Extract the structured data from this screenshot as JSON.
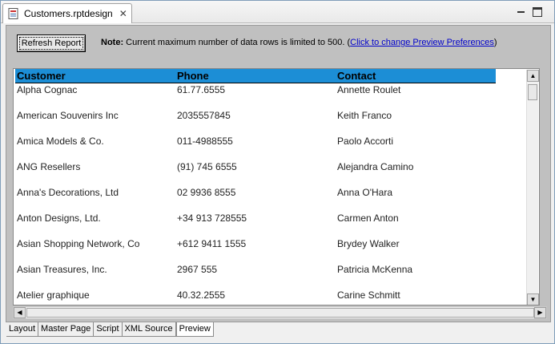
{
  "editor_tab": {
    "title": "Customers.rptdesign",
    "close_glyph": "✕"
  },
  "toolbar": {
    "refresh_label": "Refresh Report",
    "note_label": "Note:",
    "note_text": " Current maximum number of data rows is limited to 500. (",
    "note_link": "Click to change Preview Preferences",
    "note_tail": ")"
  },
  "report": {
    "columns": [
      "Customer",
      "Phone",
      "Contact"
    ],
    "rows": [
      [
        "Alpha Cognac",
        "61.77.6555",
        "Annette  Roulet"
      ],
      [
        "American Souvenirs Inc",
        "2035557845",
        "Keith Franco"
      ],
      [
        "Amica Models & Co.",
        "011-4988555",
        "Paolo  Accorti"
      ],
      [
        "ANG Resellers",
        "(91) 745 6555",
        "Alejandra  Camino"
      ],
      [
        "Anna's Decorations, Ltd",
        "02 9936 8555",
        "Anna O'Hara"
      ],
      [
        "Anton Designs, Ltd.",
        "+34 913 728555",
        "Carmen Anton"
      ],
      [
        "Asian Shopping Network, Co",
        "+612 9411 1555",
        "Brydey Walker"
      ],
      [
        "Asian Treasures, Inc.",
        "2967 555",
        "Patricia  McKenna"
      ],
      [
        "Atelier graphique",
        "40.32.2555",
        "Carine  Schmitt"
      ]
    ],
    "header_color": "#1c8ed6"
  },
  "bottom_tabs": [
    "Layout",
    "Master Page",
    "Script",
    "XML Source",
    "Preview"
  ],
  "active_bottom_tab": "Preview",
  "icons": [
    "report-file-icon",
    "close-icon",
    "minimize-icon",
    "maximize-icon",
    "scroll-up-icon",
    "scroll-down-icon",
    "scroll-left-icon",
    "scroll-right-icon"
  ]
}
